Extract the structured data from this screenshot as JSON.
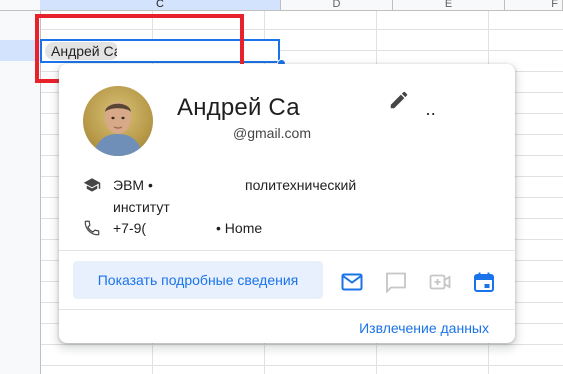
{
  "sheet": {
    "columns": [
      "C",
      "D",
      "E",
      "F"
    ],
    "chip_text": "Андрей Са"
  },
  "card": {
    "name": "Андрей Са",
    "name_trailing": "..",
    "email": "@gmail.com",
    "org_text": "ЭВМ •",
    "org_text_2": "политехнический",
    "org_line2": "институт",
    "phone": "+7-9(",
    "phone_type": "• Home",
    "details_label": "Показать подробные сведения",
    "extract_label": "Извлечение данных",
    "icons": [
      "edit-icon",
      "school-icon",
      "phone-icon",
      "email-icon",
      "chat-icon",
      "video-call-icon",
      "calendar-icon"
    ],
    "colors": {
      "accent": "#1a73e8",
      "accent_bg": "#e8f0fe",
      "annotation": "#e8222b"
    }
  }
}
